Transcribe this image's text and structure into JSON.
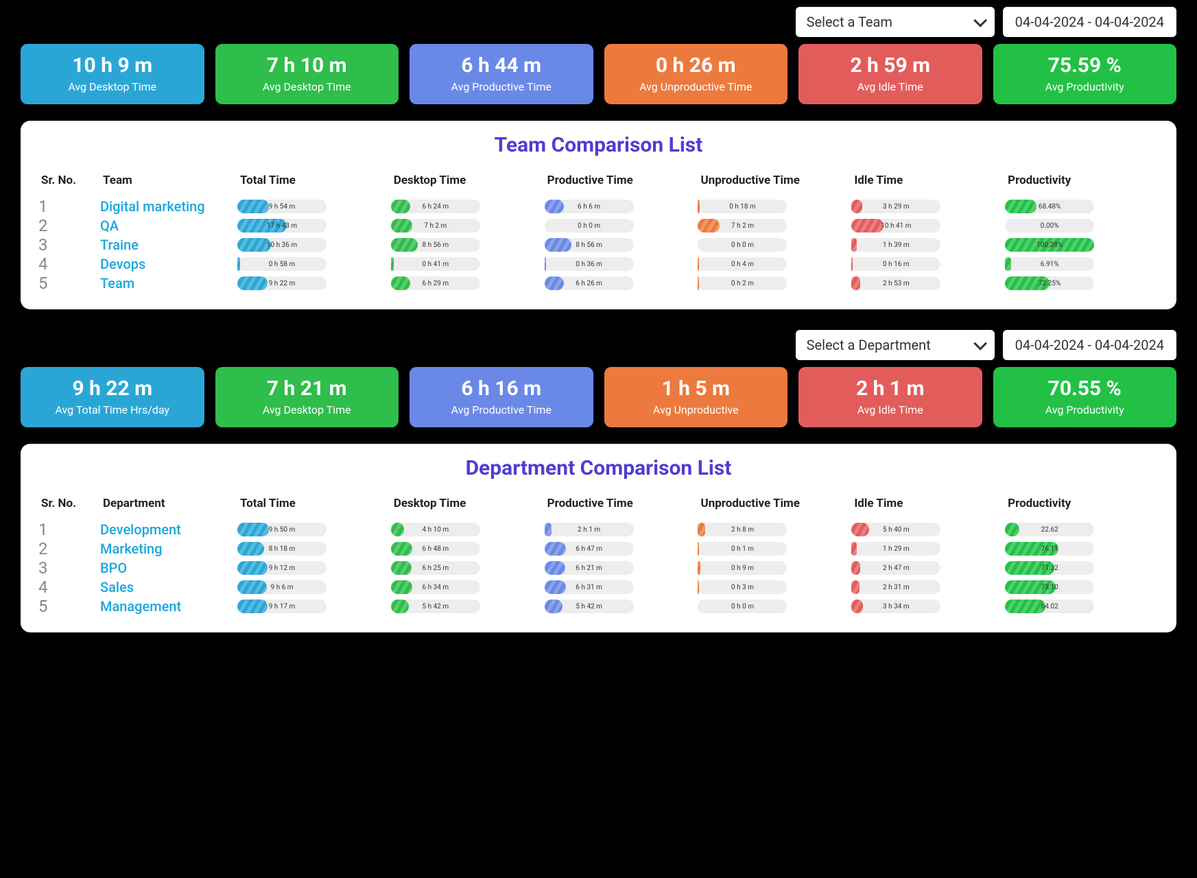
{
  "team_section": {
    "select_label": "Select a Team",
    "date_range": "04-04-2024 - 04-04-2024",
    "cards": [
      {
        "value": "10 h 9 m",
        "label": "Avg Desktop Time",
        "color": "c-teal"
      },
      {
        "value": "7 h 10 m",
        "label": "Avg Desktop Time",
        "color": "c-green2"
      },
      {
        "value": "6 h 44 m",
        "label": "Avg Productive Time",
        "color": "c-blue"
      },
      {
        "value": "0 h 26 m",
        "label": "Avg Unproductive Time",
        "color": "c-orange"
      },
      {
        "value": "2 h 59 m",
        "label": "Avg Idle Time",
        "color": "c-red"
      },
      {
        "value": "75.59 %",
        "label": "Avg Productivity",
        "color": "c-green"
      }
    ],
    "table_title": "Team Comparison List",
    "headers": [
      "Sr. No.",
      "Team",
      "Total Time",
      "Desktop Time",
      "Productive Time",
      "Unproductive Time",
      "Idle Time",
      "Productivity"
    ],
    "rows": [
      {
        "sr": "1",
        "name": "Digital marketing",
        "cells": [
          {
            "text": "9 h 54 m",
            "color": "f-teal",
            "pct": 35
          },
          {
            "text": "6 h 24 m",
            "color": "f-green",
            "pct": 22
          },
          {
            "text": "6 h 6 m",
            "color": "f-blue",
            "pct": 22
          },
          {
            "text": "0 h 18 m",
            "color": "f-orange",
            "pct": 2
          },
          {
            "text": "3 h 29 m",
            "color": "f-red",
            "pct": 12
          },
          {
            "text": "68.48%",
            "color": "f-lime",
            "pct": 35
          }
        ]
      },
      {
        "sr": "2",
        "name": "QA",
        "cells": [
          {
            "text": "17 h 43 m",
            "color": "f-teal",
            "pct": 55
          },
          {
            "text": "7 h 2 m",
            "color": "f-green",
            "pct": 24
          },
          {
            "text": "0 h 0 m",
            "color": "f-blue",
            "pct": 0
          },
          {
            "text": "7 h 2 m",
            "color": "f-orange",
            "pct": 24
          },
          {
            "text": "10 h 41 m",
            "color": "f-red",
            "pct": 36
          },
          {
            "text": "0.00%",
            "color": "f-lime",
            "pct": 0
          }
        ]
      },
      {
        "sr": "3",
        "name": "Traine",
        "cells": [
          {
            "text": "10 h 36 m",
            "color": "f-teal",
            "pct": 38
          },
          {
            "text": "8 h 56 m",
            "color": "f-green",
            "pct": 30
          },
          {
            "text": "8 h 56 m",
            "color": "f-blue",
            "pct": 30
          },
          {
            "text": "0 h 0 m",
            "color": "f-orange",
            "pct": 0
          },
          {
            "text": "1 h 39 m",
            "color": "f-red",
            "pct": 6
          },
          {
            "text": "100.28%",
            "color": "f-lime",
            "pct": 100
          }
        ]
      },
      {
        "sr": "4",
        "name": "Devops",
        "cells": [
          {
            "text": "0 h 58 m",
            "color": "f-teal",
            "pct": 3
          },
          {
            "text": "0 h 41 m",
            "color": "f-green",
            "pct": 3
          },
          {
            "text": "0 h 36 m",
            "color": "f-blue",
            "pct": 2
          },
          {
            "text": "0 h 4 m",
            "color": "f-orange",
            "pct": 1
          },
          {
            "text": "0 h 16 m",
            "color": "f-red",
            "pct": 1
          },
          {
            "text": "6.91%",
            "color": "f-lime",
            "pct": 7
          }
        ]
      },
      {
        "sr": "5",
        "name": "Team",
        "cells": [
          {
            "text": "9 h 22 m",
            "color": "f-teal",
            "pct": 34
          },
          {
            "text": "6 h 29 m",
            "color": "f-green",
            "pct": 22
          },
          {
            "text": "6 h 26 m",
            "color": "f-blue",
            "pct": 22
          },
          {
            "text": "0 h 2 m",
            "color": "f-orange",
            "pct": 1
          },
          {
            "text": "2 h 53 m",
            "color": "f-red",
            "pct": 10
          },
          {
            "text": "72.25%",
            "color": "f-lime",
            "pct": 50
          }
        ]
      }
    ]
  },
  "dept_section": {
    "select_label": "Select a Department",
    "date_range": "04-04-2024 - 04-04-2024",
    "cards": [
      {
        "value": "9 h 22 m",
        "label": "Avg Total Time Hrs/day",
        "color": "c-teal"
      },
      {
        "value": "7 h 21 m",
        "label": "Avg Desktop Time",
        "color": "c-green2"
      },
      {
        "value": "6 h 16 m",
        "label": "Avg Productive Time",
        "color": "c-blue"
      },
      {
        "value": "1 h 5 m",
        "label": "Avg Unproductive",
        "color": "c-orange"
      },
      {
        "value": "2 h 1 m",
        "label": "Avg Idle Time",
        "color": "c-red"
      },
      {
        "value": "70.55 %",
        "label": "Avg Productivity",
        "color": "c-green"
      }
    ],
    "table_title": "Department Comparison List",
    "headers": [
      "Sr. No.",
      "Department",
      "Total Time",
      "Desktop Time",
      "Productive Time",
      "Unproductive Time",
      "Idle Time",
      "Productivity"
    ],
    "rows": [
      {
        "sr": "1",
        "name": "Development",
        "cells": [
          {
            "text": "9 h 50 m",
            "color": "f-teal",
            "pct": 35
          },
          {
            "text": "4 h 10 m",
            "color": "f-green",
            "pct": 15
          },
          {
            "text": "2 h 1 m",
            "color": "f-blue",
            "pct": 8
          },
          {
            "text": "2 h 8 m",
            "color": "f-orange",
            "pct": 8
          },
          {
            "text": "5 h 40 m",
            "color": "f-red",
            "pct": 20
          },
          {
            "text": "22.62",
            "color": "f-lime",
            "pct": 16
          }
        ]
      },
      {
        "sr": "2",
        "name": "Marketing",
        "cells": [
          {
            "text": "8 h 18 m",
            "color": "f-teal",
            "pct": 30
          },
          {
            "text": "6 h 48 m",
            "color": "f-green",
            "pct": 24
          },
          {
            "text": "6 h 47 m",
            "color": "f-blue",
            "pct": 24
          },
          {
            "text": "0 h 1 m",
            "color": "f-orange",
            "pct": 1
          },
          {
            "text": "1 h 29 m",
            "color": "f-red",
            "pct": 6
          },
          {
            "text": "76.11",
            "color": "f-lime",
            "pct": 60
          }
        ]
      },
      {
        "sr": "3",
        "name": "BPO",
        "cells": [
          {
            "text": "9 h 12 m",
            "color": "f-teal",
            "pct": 34
          },
          {
            "text": "6 h 25 m",
            "color": "f-green",
            "pct": 23
          },
          {
            "text": "6 h 21 m",
            "color": "f-blue",
            "pct": 23
          },
          {
            "text": "0 h 9 m",
            "color": "f-orange",
            "pct": 3
          },
          {
            "text": "2 h 47 m",
            "color": "f-red",
            "pct": 10
          },
          {
            "text": "71.32",
            "color": "f-lime",
            "pct": 55
          }
        ]
      },
      {
        "sr": "4",
        "name": "Sales",
        "cells": [
          {
            "text": "9 h 6 m",
            "color": "f-teal",
            "pct": 33
          },
          {
            "text": "6 h 34 m",
            "color": "f-green",
            "pct": 24
          },
          {
            "text": "6 h 31 m",
            "color": "f-blue",
            "pct": 24
          },
          {
            "text": "0 h 3 m",
            "color": "f-orange",
            "pct": 1
          },
          {
            "text": "2 h 31 m",
            "color": "f-red",
            "pct": 9
          },
          {
            "text": "73.10",
            "color": "f-lime",
            "pct": 57
          }
        ]
      },
      {
        "sr": "5",
        "name": "Management",
        "cells": [
          {
            "text": "9 h 17 m",
            "color": "f-teal",
            "pct": 34
          },
          {
            "text": "5 h 42 m",
            "color": "f-green",
            "pct": 20
          },
          {
            "text": "5 h 42 m",
            "color": "f-blue",
            "pct": 20
          },
          {
            "text": "0 h 0 m",
            "color": "f-orange",
            "pct": 0
          },
          {
            "text": "3 h 34 m",
            "color": "f-red",
            "pct": 13
          },
          {
            "text": "64.02",
            "color": "f-lime",
            "pct": 45
          }
        ]
      }
    ]
  }
}
